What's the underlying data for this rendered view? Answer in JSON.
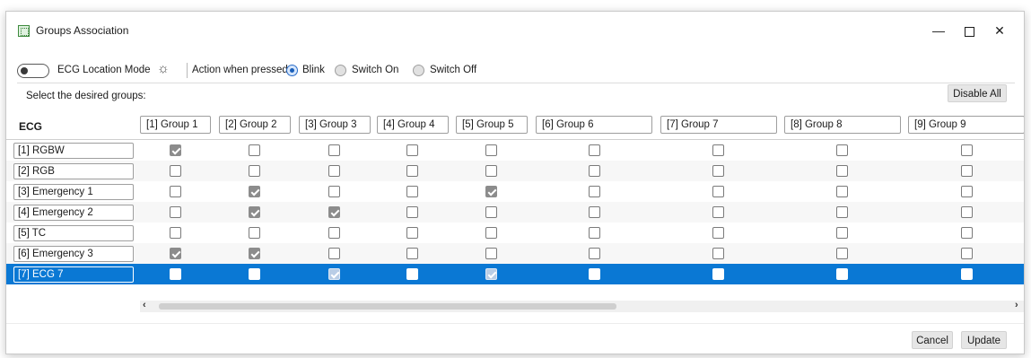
{
  "window": {
    "title": "Groups Association",
    "controls": {
      "minimize": "—",
      "close": "✕"
    }
  },
  "toolbar": {
    "location_mode_label": "ECG Location Mode",
    "location_mode_on": false,
    "bulb_glyph": "☼",
    "action_label": "Action when pressed:",
    "actions": [
      {
        "label": "Blink",
        "selected": true
      },
      {
        "label": "Switch On",
        "selected": false
      },
      {
        "label": "Switch Off",
        "selected": false
      }
    ]
  },
  "select_label": "Select the desired groups:",
  "disable_all_label": "Disable All",
  "grid": {
    "ecg_header": "ECG",
    "groups": [
      "[1] Group 1",
      "[2] Group 2",
      "[3] Group 3",
      "[4] Group 4",
      "[5] Group 5",
      "[6] Group 6",
      "[7] Group 7",
      "[8] Group 8",
      "[9] Group 9"
    ],
    "rows": [
      {
        "ecg": "[1] RGBW",
        "checks": [
          true,
          false,
          false,
          false,
          false,
          false,
          false,
          false,
          false
        ],
        "selected": false
      },
      {
        "ecg": "[2] RGB",
        "checks": [
          false,
          false,
          false,
          false,
          false,
          false,
          false,
          false,
          false
        ],
        "selected": false
      },
      {
        "ecg": "[3] Emergency 1",
        "checks": [
          false,
          true,
          false,
          false,
          true,
          false,
          false,
          false,
          false
        ],
        "selected": false
      },
      {
        "ecg": "[4] Emergency 2",
        "checks": [
          false,
          true,
          true,
          false,
          false,
          false,
          false,
          false,
          false
        ],
        "selected": false
      },
      {
        "ecg": "[5] TC",
        "checks": [
          false,
          false,
          false,
          false,
          false,
          false,
          false,
          false,
          false
        ],
        "selected": false
      },
      {
        "ecg": "[6] Emergency 3",
        "checks": [
          true,
          true,
          false,
          false,
          false,
          false,
          false,
          false,
          false
        ],
        "selected": false
      },
      {
        "ecg": "[7] ECG 7",
        "checks": [
          false,
          false,
          true,
          false,
          true,
          false,
          false,
          false,
          false
        ],
        "selected": true
      }
    ]
  },
  "scroll": {
    "left_arrow": "‹",
    "right_arrow": "›",
    "thumb_fraction": 0.52
  },
  "footer": {
    "cancel_label": "Cancel",
    "update_label": "Update"
  },
  "colors": {
    "selection": "#0a78d4",
    "checked": "#8c8c8c",
    "radio_accent": "#1a5fba"
  }
}
